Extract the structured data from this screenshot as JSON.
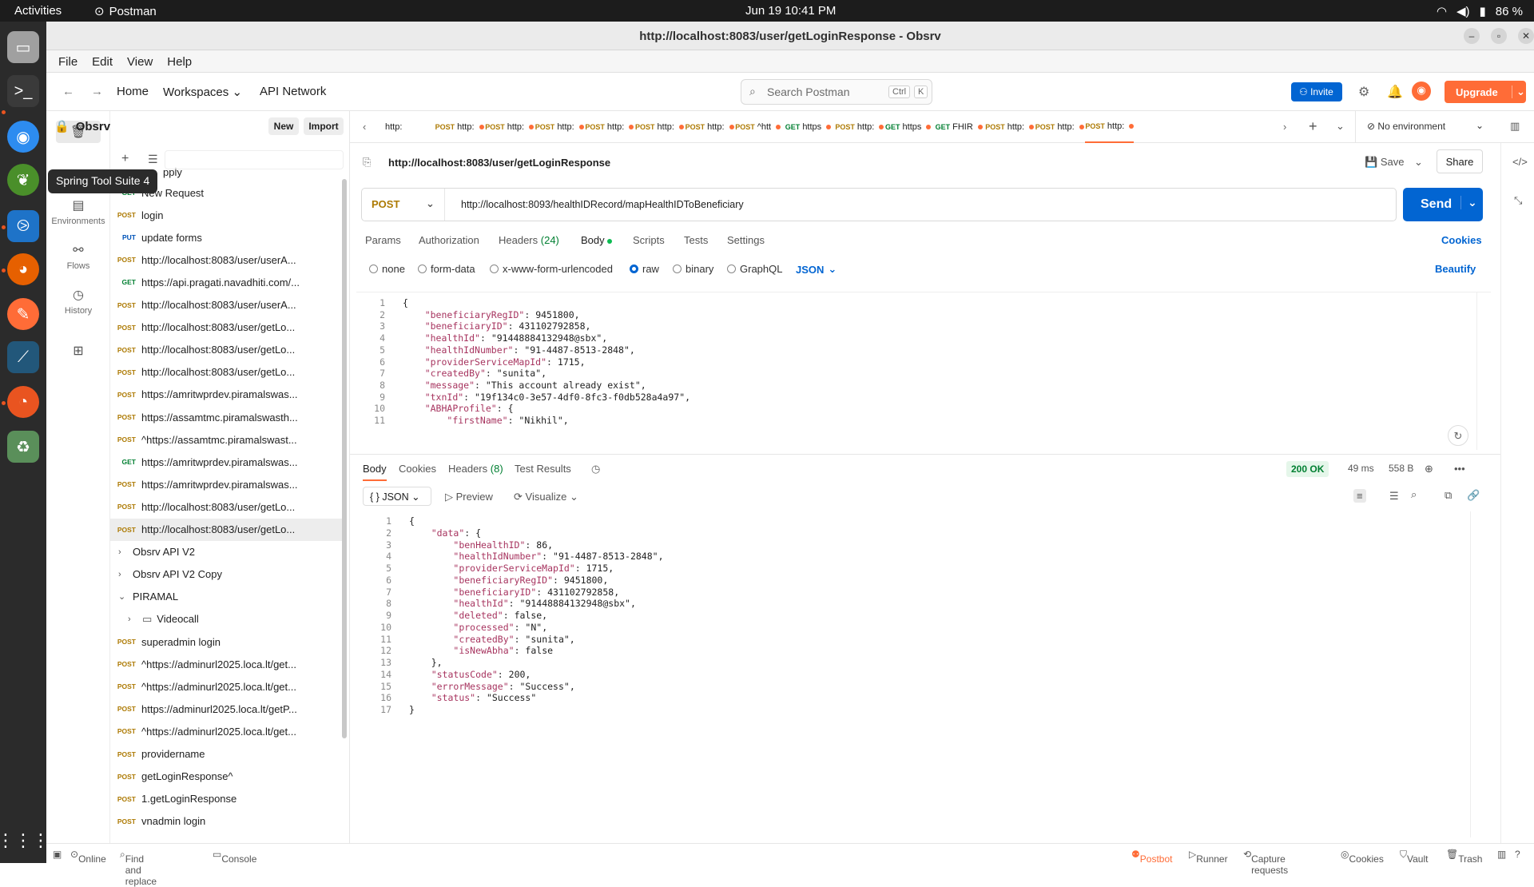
{
  "os": {
    "activities": "Activities",
    "app_name": "Postman",
    "clock": "Jun 19  10:41 PM",
    "battery": "86 %",
    "dock_tooltip": "Spring Tool Suite 4"
  },
  "window": {
    "title": "http://localhost:8083/user/getLoginResponse - Obsrv"
  },
  "menubar": [
    "File",
    "Edit",
    "View",
    "Help"
  ],
  "header": {
    "home": "Home",
    "workspaces": "Workspaces",
    "api_network": "API Network",
    "search_placeholder": "Search Postman",
    "search_kbd1": "Ctrl",
    "search_kbd2": "K",
    "invite": "Invite",
    "upgrade": "Upgrade"
  },
  "rail": {
    "environments": "Environments",
    "flows": "Flows",
    "history": "History"
  },
  "sidebar": {
    "workspace": "Obsrv",
    "new": "New",
    "import": "Import",
    "partial_top": "pply",
    "items": [
      {
        "method": "GET",
        "name": "New Request"
      },
      {
        "method": "POST",
        "name": "login"
      },
      {
        "method": "PUT",
        "name": "update forms"
      },
      {
        "method": "POST",
        "name": "http://localhost:8083/user/userA..."
      },
      {
        "method": "GET",
        "name": "https://api.pragati.navadhiti.com/..."
      },
      {
        "method": "POST",
        "name": "http://localhost:8083/user/userA..."
      },
      {
        "method": "POST",
        "name": "http://localhost:8083/user/getLo..."
      },
      {
        "method": "POST",
        "name": "http://localhost:8083/user/getLo..."
      },
      {
        "method": "POST",
        "name": "http://localhost:8083/user/getLo..."
      },
      {
        "method": "POST",
        "name": "https://amritwprdev.piramalswas..."
      },
      {
        "method": "POST",
        "name": "https://assamtmc.piramalswasth..."
      },
      {
        "method": "POST",
        "name": "^https://assamtmc.piramalswast..."
      },
      {
        "method": "GET",
        "name": "https://amritwprdev.piramalswas..."
      },
      {
        "method": "POST",
        "name": "https://amritwprdev.piramalswas..."
      },
      {
        "method": "POST",
        "name": "http://localhost:8083/user/getLo..."
      },
      {
        "method": "POST",
        "name": "http://localhost:8083/user/getLo..."
      }
    ],
    "collections": [
      "Obsrv API V2",
      "Obsrv API V2 Copy",
      "PIRAMAL"
    ],
    "folder": "Videocall",
    "piramal_items": [
      {
        "method": "POST",
        "name": "superadmin login"
      },
      {
        "method": "POST",
        "name": "^https://adminurl2025.loca.lt/get..."
      },
      {
        "method": "POST",
        "name": "^https://adminurl2025.loca.lt/get..."
      },
      {
        "method": "POST",
        "name": "https://adminurl2025.loca.lt/getP..."
      },
      {
        "method": "POST",
        "name": "^https://adminurl2025.loca.lt/get..."
      },
      {
        "method": "POST",
        "name": "providername"
      },
      {
        "method": "POST",
        "name": "getLoginResponse^"
      },
      {
        "method": "POST",
        "name": "1.getLoginResponse"
      },
      {
        "method": "POST",
        "name": "vnadmin login"
      }
    ]
  },
  "tabs": [
    {
      "method": "",
      "label": "http:"
    },
    {
      "method": "POST",
      "label": "http:"
    },
    {
      "method": "POST",
      "label": "http:"
    },
    {
      "method": "POST",
      "label": "http:"
    },
    {
      "method": "POST",
      "label": "http:"
    },
    {
      "method": "POST",
      "label": "http:"
    },
    {
      "method": "POST",
      "label": "http:"
    },
    {
      "method": "POST",
      "label": "^htt"
    },
    {
      "method": "GET",
      "label": "https"
    },
    {
      "method": "POST",
      "label": "http:"
    },
    {
      "method": "GET",
      "label": "https"
    },
    {
      "method": "GET",
      "label": "FHIR"
    },
    {
      "method": "POST",
      "label": "http:"
    },
    {
      "method": "POST",
      "label": "http:"
    },
    {
      "method": "POST",
      "label": "http:"
    }
  ],
  "environment": "No environment",
  "request": {
    "title": "http://localhost:8083/user/getLoginResponse",
    "save": "Save",
    "share": "Share",
    "method": "POST",
    "url": "http://localhost:8093/healthIDRecord/mapHealthIDToBeneficiary",
    "send": "Send",
    "tabs": [
      "Params",
      "Authorization",
      "Headers",
      "(24)",
      "Body",
      "Scripts",
      "Tests",
      "Settings"
    ],
    "cookies": "Cookies",
    "body_modes": [
      "none",
      "form-data",
      "x-www-form-urlencoded",
      "raw",
      "binary",
      "GraphQL"
    ],
    "format": "JSON",
    "beautify": "Beautify",
    "body_lines": [
      "{",
      "    \"beneficiaryRegID\": 9451800,",
      "    \"beneficiaryID\": 431102792858,",
      "    \"healthId\": \"91448884132948@sbx\",",
      "    \"healthIdNumber\": \"91-4487-8513-2848\",",
      "    \"providerServiceMapId\": 1715,",
      "    \"createdBy\": \"sunita\",",
      "    \"message\": \"This account already exist\",",
      "    \"txnId\": \"19f134c0-3e57-4df0-8fc3-f0db528a4a97\",",
      "    \"ABHAProfile\": {",
      "        \"firstName\": \"Nikhil\","
    ]
  },
  "response": {
    "tabs": [
      "Body",
      "Cookies",
      "Headers",
      "(8)",
      "Test Results"
    ],
    "status": "200 OK",
    "time": "49 ms",
    "size": "558 B",
    "format": "JSON",
    "preview": "Preview",
    "visualize": "Visualize",
    "body_lines": [
      "{",
      "    \"data\": {",
      "        \"benHealthID\": 86,",
      "        \"healthIdNumber\": \"91-4487-8513-2848\",",
      "        \"providerServiceMapId\": 1715,",
      "        \"beneficiaryRegID\": 9451800,",
      "        \"beneficiaryID\": 431102792858,",
      "        \"healthId\": \"91448884132948@sbx\",",
      "        \"deleted\": false,",
      "        \"processed\": \"N\",",
      "        \"createdBy\": \"sunita\",",
      "        \"isNewAbha\": false",
      "    },",
      "    \"statusCode\": 200,",
      "    \"errorMessage\": \"Success\",",
      "    \"status\": \"Success\"",
      "}"
    ]
  },
  "statusbar": {
    "online": "Online",
    "find": "Find and replace",
    "console": "Console",
    "postbot": "Postbot",
    "runner": "Runner",
    "capture": "Capture requests",
    "cookies": "Cookies",
    "vault": "Vault",
    "trash": "Trash"
  },
  "colors": {
    "accent": "#ff6c37",
    "primary": "#0265d2",
    "status_ok": "#007f31"
  }
}
